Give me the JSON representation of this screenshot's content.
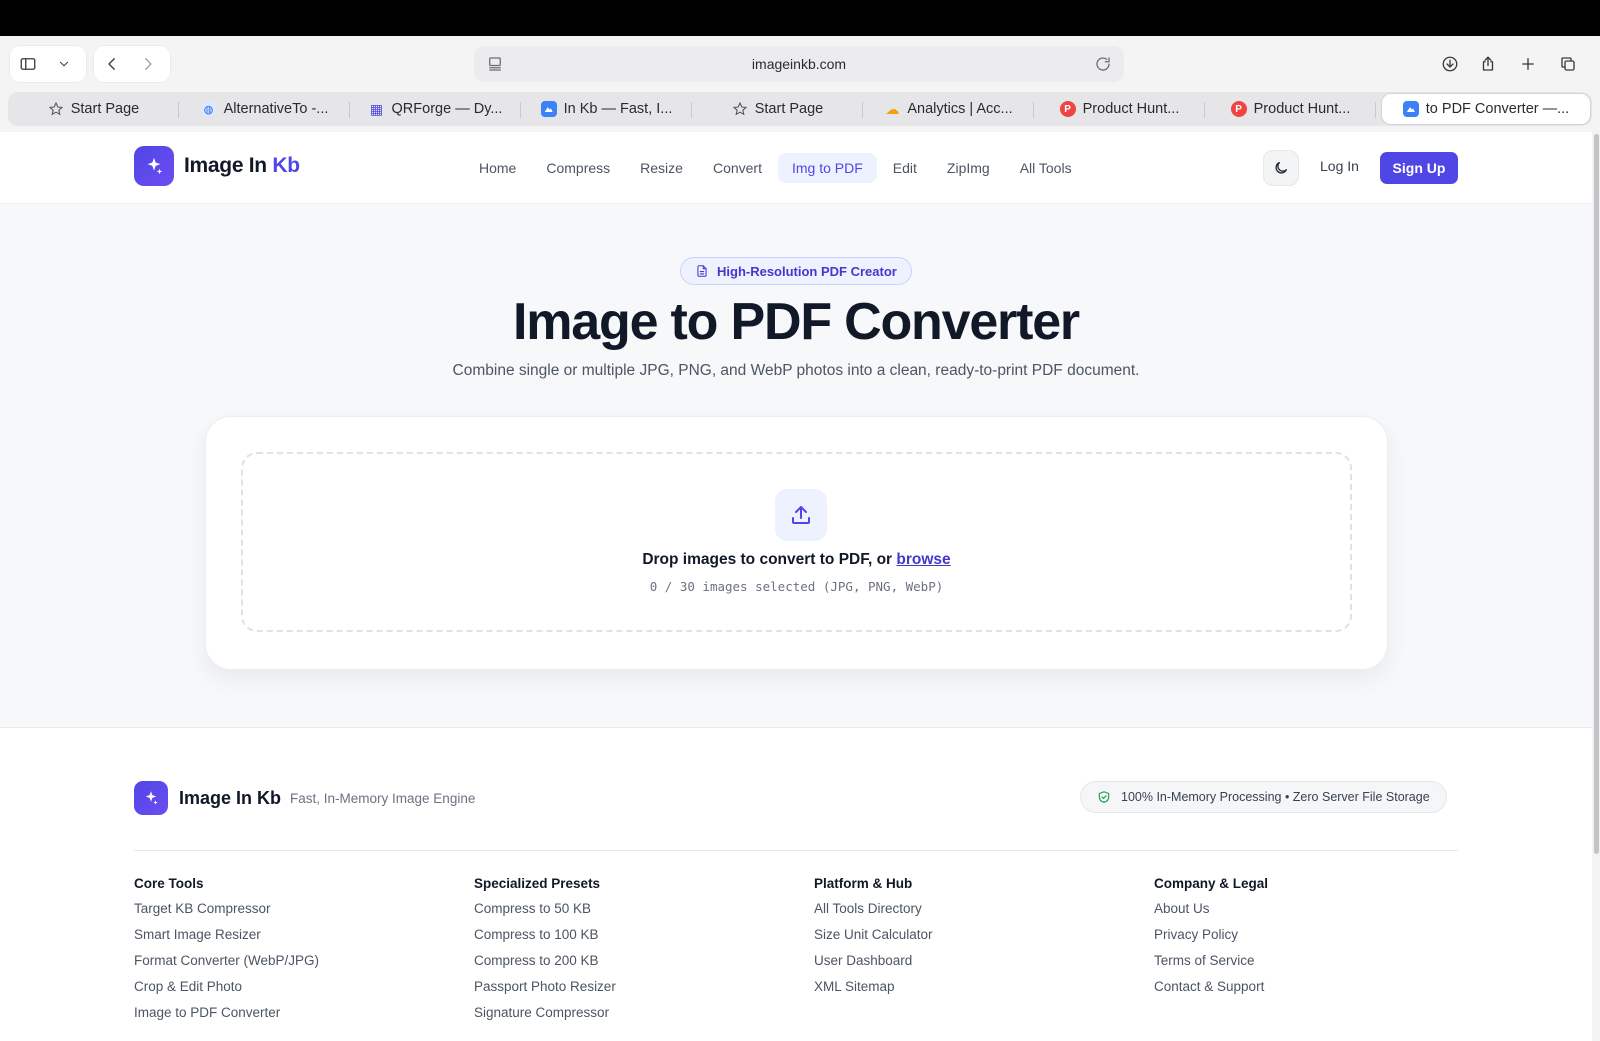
{
  "browser": {
    "url": "imageinkb.com",
    "tabs": [
      {
        "label": "Start Page",
        "icon": "star-icon"
      },
      {
        "label": "AlternativeTo -...",
        "icon": "globe-icon"
      },
      {
        "label": "QRForge — Dy...",
        "icon": "qr-icon"
      },
      {
        "label": "In Kb — Fast, I...",
        "icon": "image-icon"
      },
      {
        "label": "Start Page",
        "icon": "star-icon"
      },
      {
        "label": "Analytics | Acc...",
        "icon": "cloud-icon"
      },
      {
        "label": "Product Hunt...",
        "icon": "product-hunt-icon"
      },
      {
        "label": "Product Hunt...",
        "icon": "product-hunt-icon"
      },
      {
        "label": "to PDF Converter —...",
        "icon": "image-icon"
      }
    ],
    "ph_letter": "P"
  },
  "site": {
    "logo_main": "Image In",
    "logo_accent": "Kb",
    "accent_color": "#4f46e5",
    "nav": [
      {
        "label": "Home"
      },
      {
        "label": "Compress"
      },
      {
        "label": "Resize"
      },
      {
        "label": "Convert"
      },
      {
        "label": "Img to PDF",
        "active": true
      },
      {
        "label": "Edit"
      },
      {
        "label": "ZipImg"
      },
      {
        "label": "All Tools"
      }
    ],
    "login": "Log In",
    "signup": "Sign Up"
  },
  "hero": {
    "badge": "High-Resolution PDF Creator",
    "title": "Image to PDF Converter",
    "subtitle": "Combine single or multiple JPG, PNG, and WebP photos into a clean, ready-to-print PDF document."
  },
  "dropzone": {
    "text": "Drop images to convert to PDF, or",
    "browse": "browse",
    "count": "0 / 30 images selected (JPG, PNG, WebP)"
  },
  "footer": {
    "brand": "Image In Kb",
    "tagline": "Fast, In-Memory Image Engine",
    "badge": "100% In-Memory Processing • Zero Server File Storage",
    "columns": [
      {
        "title": "Core Tools",
        "links": [
          "Target KB Compressor",
          "Smart Image Resizer",
          "Format Converter (WebP/JPG)",
          "Crop & Edit Photo",
          "Image to PDF Converter"
        ]
      },
      {
        "title": "Specialized Presets",
        "links": [
          "Compress to 50 KB",
          "Compress to 100 KB",
          "Compress to 200 KB",
          "Passport Photo Resizer",
          "Signature Compressor"
        ]
      },
      {
        "title": "Platform & Hub",
        "links": [
          "All Tools Directory",
          "Size Unit Calculator",
          "User Dashboard",
          "XML Sitemap"
        ]
      },
      {
        "title": "Company & Legal",
        "links": [
          "About Us",
          "Privacy Policy",
          "Terms of Service",
          "Contact & Support"
        ]
      }
    ]
  }
}
